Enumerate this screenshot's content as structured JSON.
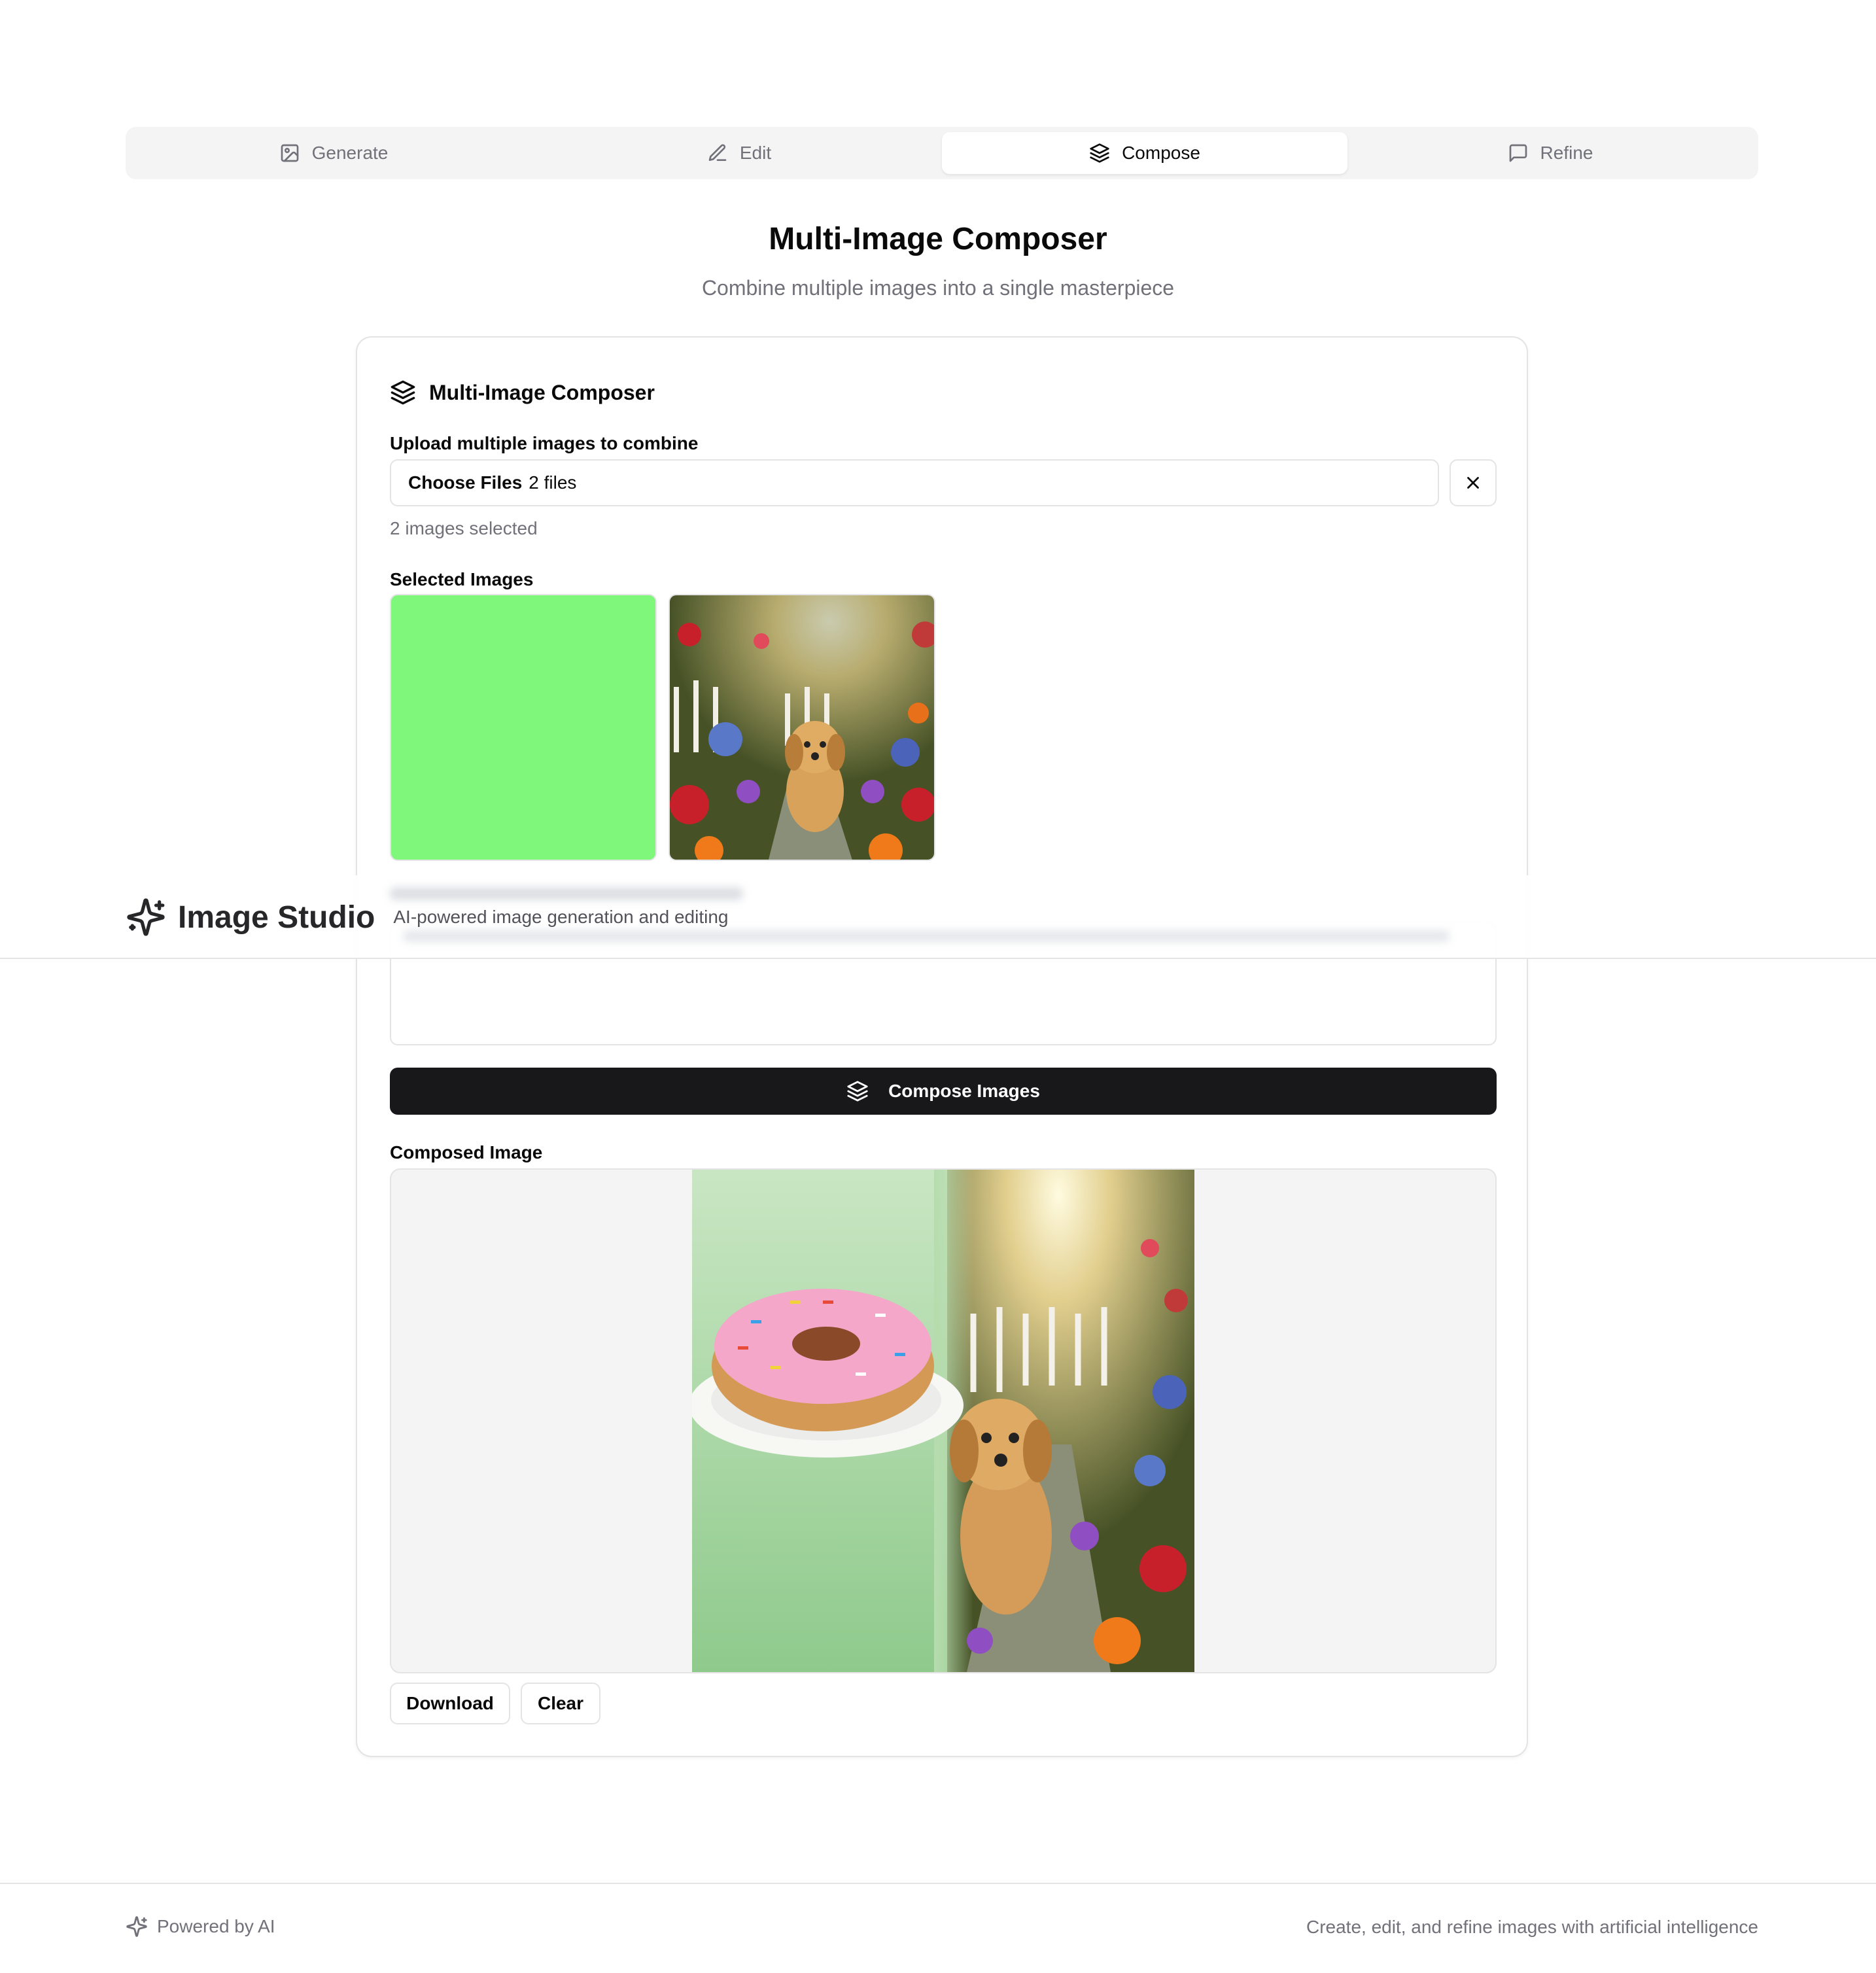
{
  "tabs": [
    {
      "label": "Generate",
      "icon": "image-icon"
    },
    {
      "label": "Edit",
      "icon": "pencil-icon"
    },
    {
      "label": "Compose",
      "icon": "layers-icon",
      "active": true
    },
    {
      "label": "Refine",
      "icon": "message-square-icon"
    }
  ],
  "page": {
    "title": "Multi-Image Composer",
    "subtitle": "Combine multiple images into a single masterpiece"
  },
  "composer": {
    "card_title": "Multi-Image Composer",
    "upload_label": "Upload multiple images to combine",
    "choose_files_label": "Choose Files",
    "file_status": "2 files",
    "count_text": "2 images selected",
    "selected_label": "Selected Images",
    "compose_button": "Compose Images",
    "result_label": "Composed Image",
    "download_button": "Download",
    "clear_button": "Clear"
  },
  "header": {
    "brand": "Image Studio",
    "tagline": "AI-powered image generation and editing"
  },
  "footer": {
    "left": "Powered by AI",
    "right": "Create, edit, and refine images with artificial intelligence"
  },
  "colors": {
    "accent": "#18181b",
    "thumb_green": "#7ef77b",
    "muted_text": "#71717a",
    "border": "#e4e4e7"
  }
}
